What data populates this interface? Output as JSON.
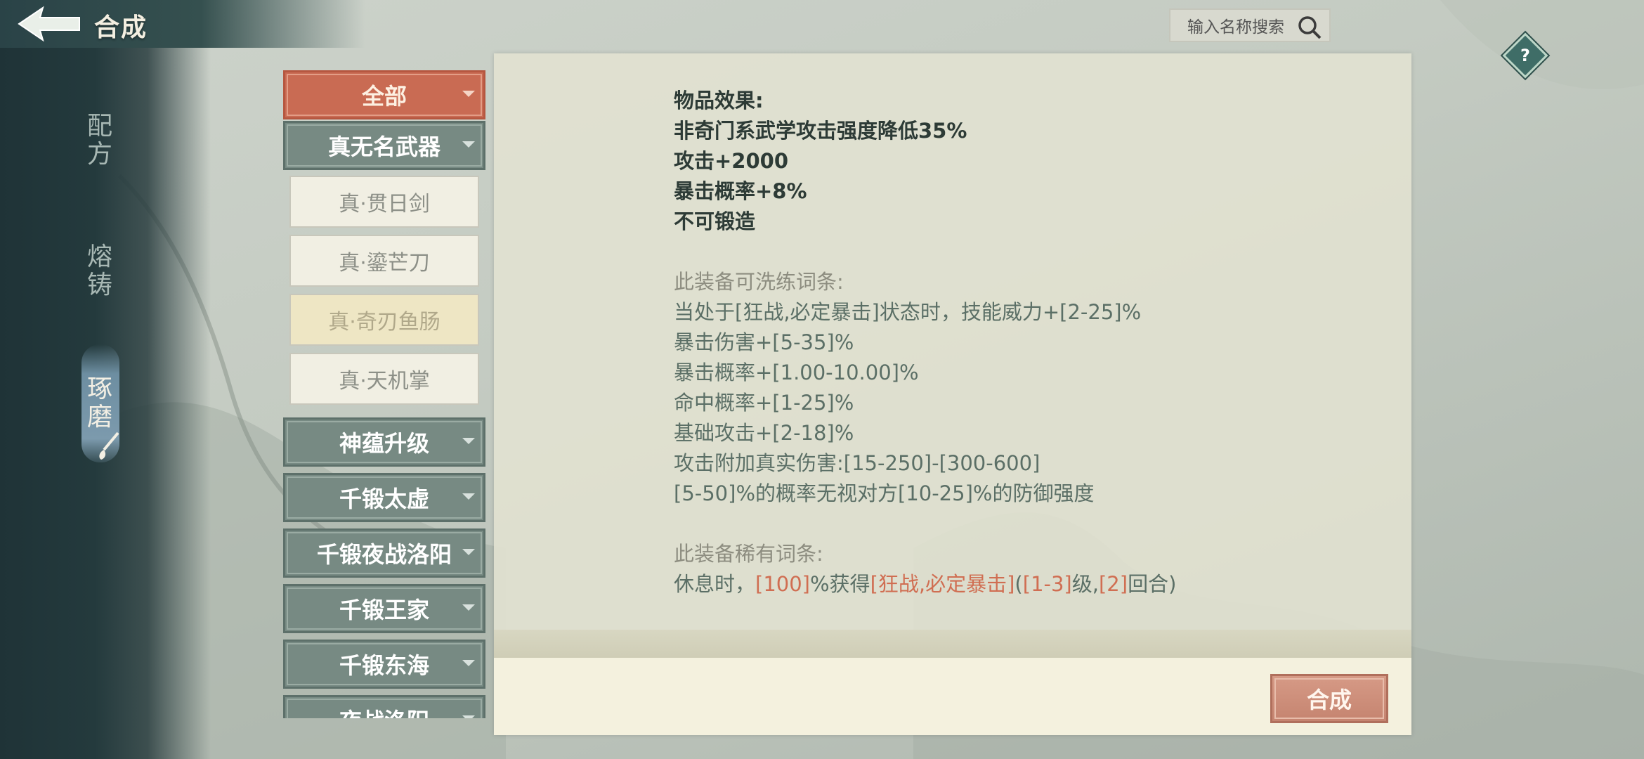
{
  "header": {
    "title": "合成",
    "back_icon": "back-arrow-icon"
  },
  "search": {
    "placeholder": "输入名称搜索",
    "icon": "search-icon"
  },
  "help": {
    "label": "?"
  },
  "side_tabs": [
    {
      "label": "配\n方",
      "active": false
    },
    {
      "label": "熔\n铸",
      "active": false
    },
    {
      "label": "琢\n磨",
      "active": true
    }
  ],
  "categories": {
    "all": "全部",
    "weapons": "真无名武器",
    "weapon_items": [
      "真·贯日剑",
      "真·鎏芒刀",
      "真·奇刃鱼肠",
      "真·天机掌"
    ],
    "others": [
      "神蕴升级",
      "千锻太虚",
      "千锻夜战洛阳",
      "千锻王家",
      "千锻东海",
      "夜战洛阳"
    ]
  },
  "effects": {
    "title": "物品效果:",
    "lines": [
      "非奇门系武学攻击强度降低35%",
      "攻击+2000",
      "暴击概率+8%",
      "不可锻造"
    ],
    "refine_title": "此装备可洗练词条:",
    "refine_lines": [
      "当处于[狂战,必定暴击]状态时，技能威力+[2-25]%",
      "暴击伤害+[5-35]%",
      "暴击概率+[1.00-10.00]%",
      "命中概率+[1-25]%",
      "基础攻击+[2-18]%",
      "攻击附加真实伤害:[15-250]-[300-600]",
      "[5-50]%的概率无视对方[10-25]%的防御强度"
    ],
    "rare_title": "此装备稀有词条:",
    "rare_parts": [
      "休息时，",
      "[100]",
      "%获得",
      "[狂战,必定暴击]",
      "(",
      "[1-3]",
      "级,",
      "[2]",
      "回合)"
    ]
  },
  "craft_button": "合成",
  "colors": {
    "accent": "#c96b53",
    "category_bg": "#778a83",
    "highlight_red": "#d06e52"
  }
}
